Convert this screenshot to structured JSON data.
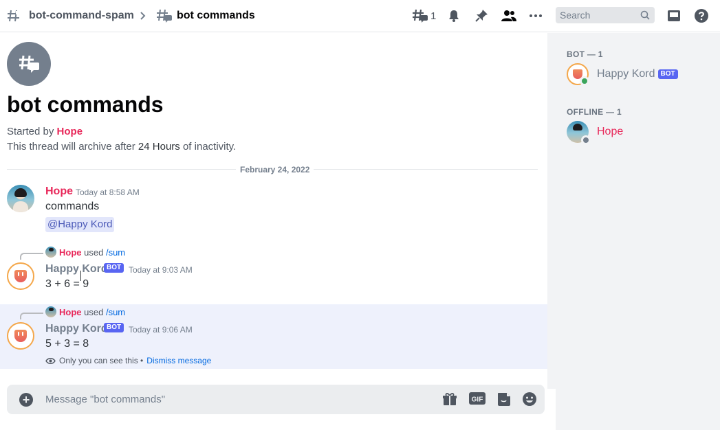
{
  "header": {
    "parent_channel": "bot-command-spam",
    "thread_title": "bot commands",
    "threads_count": "1",
    "search_placeholder": "Search"
  },
  "thread": {
    "title": "bot commands",
    "started_by_prefix": "Started by",
    "starter": "Hope",
    "archive_prefix": "This thread will archive after",
    "archive_duration": "24 Hours",
    "archive_suffix": "of inactivity."
  },
  "divider_date": "February 24, 2022",
  "messages": [
    {
      "author": "Hope",
      "time": "Today at 8:58 AM",
      "text": "commands",
      "mention": "@Happy Kord"
    },
    {
      "reply_user": "Hope",
      "reply_used": "used",
      "reply_command": "/sum",
      "author": "Happy Kord",
      "tag": "BOT",
      "time": "Today at 9:03 AM",
      "text": "3 + 6 = 9"
    },
    {
      "reply_user": "Hope",
      "reply_used": "used",
      "reply_command": "/sum",
      "author": "Happy Kord",
      "tag": "BOT",
      "time": "Today at 9:06 AM",
      "text": "5 + 3 = 8",
      "ephemeral_note": "Only you can see this •",
      "dismiss": "Dismiss message"
    }
  ],
  "composer": {
    "placeholder": "Message \"bot commands\"",
    "gif_label": "GIF"
  },
  "members": {
    "groups": [
      {
        "header": "BOT — 1",
        "name": "Happy Kord",
        "tag": "BOT",
        "status": "online",
        "status_color": "#3ba55c"
      },
      {
        "header": "OFFLINE — 1",
        "name": "Hope",
        "status": "offline",
        "status_color": "#747f8d"
      }
    ]
  },
  "colors": {
    "accent": "#5865f2",
    "username_hope": "#e8285a",
    "link": "#0068e0"
  }
}
